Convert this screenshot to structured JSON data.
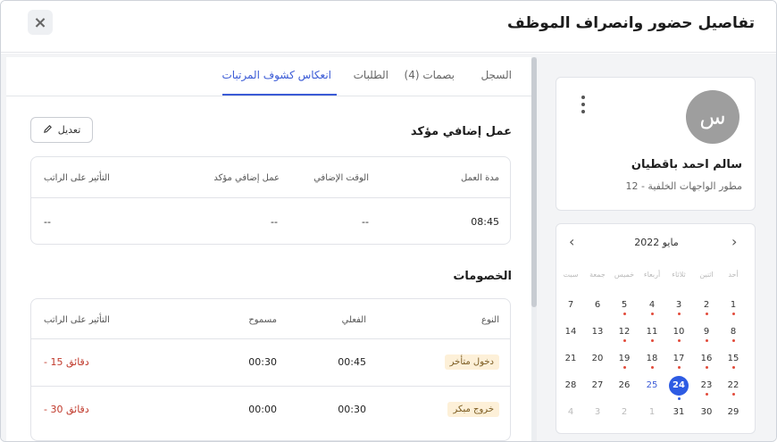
{
  "header": {
    "title": "تفاصيل حضور وانصراف الموظف",
    "close_icon": "×"
  },
  "tabs": [
    {
      "label": "السجل"
    },
    {
      "label": "بصمات (4)"
    },
    {
      "label": "الطلبات"
    },
    {
      "label": "انعكاس كشوف المرتبات",
      "active": true
    }
  ],
  "overtime": {
    "title": "عمل إضافي مؤكد",
    "edit_label": "تعديل",
    "columns": [
      "مدة العمل",
      "الوقت الإضافي",
      "عمل إضافي مؤكد",
      "التأثير على الراتب"
    ],
    "row": [
      "08:45",
      "--",
      "--",
      "--"
    ]
  },
  "deductions": {
    "title": "الخصومات",
    "columns": [
      "النوع",
      "الفعلي",
      "مسموح",
      "التأثير على الراتب"
    ],
    "rows": [
      {
        "type": "دخول متأخر",
        "actual": "00:45",
        "allowed": "00:30",
        "impact": "- 15 دقائق"
      },
      {
        "type": "خروج مبكر",
        "actual": "00:30",
        "allowed": "00:00",
        "impact": "- 30 دقائق"
      }
    ]
  },
  "profile": {
    "initial": "س",
    "name": "سالم احمد باقطيان",
    "role": "مطور الواجهات الخلفية - 12"
  },
  "calendar": {
    "month_label": "مايو 2022",
    "weekdays": [
      "أحد",
      "اثنين",
      "ثلاثاء",
      "أربعاء",
      "خميس",
      "جمعة",
      "سبت"
    ],
    "weeks": [
      [
        "1",
        "2",
        "3",
        "4",
        "5",
        "6",
        "7"
      ],
      [
        "8",
        "9",
        "10",
        "11",
        "12",
        "13",
        "14"
      ],
      [
        "15",
        "16",
        "17",
        "18",
        "19",
        "20",
        "21"
      ],
      [
        "22",
        "23",
        "24",
        "25",
        "26",
        "27",
        "28"
      ],
      [
        "29",
        "30",
        "31",
        "1",
        "2",
        "3",
        "4"
      ]
    ],
    "today": "24",
    "colors": {
      "accent": "#2d5be3",
      "dot": "#e24b3b"
    }
  }
}
